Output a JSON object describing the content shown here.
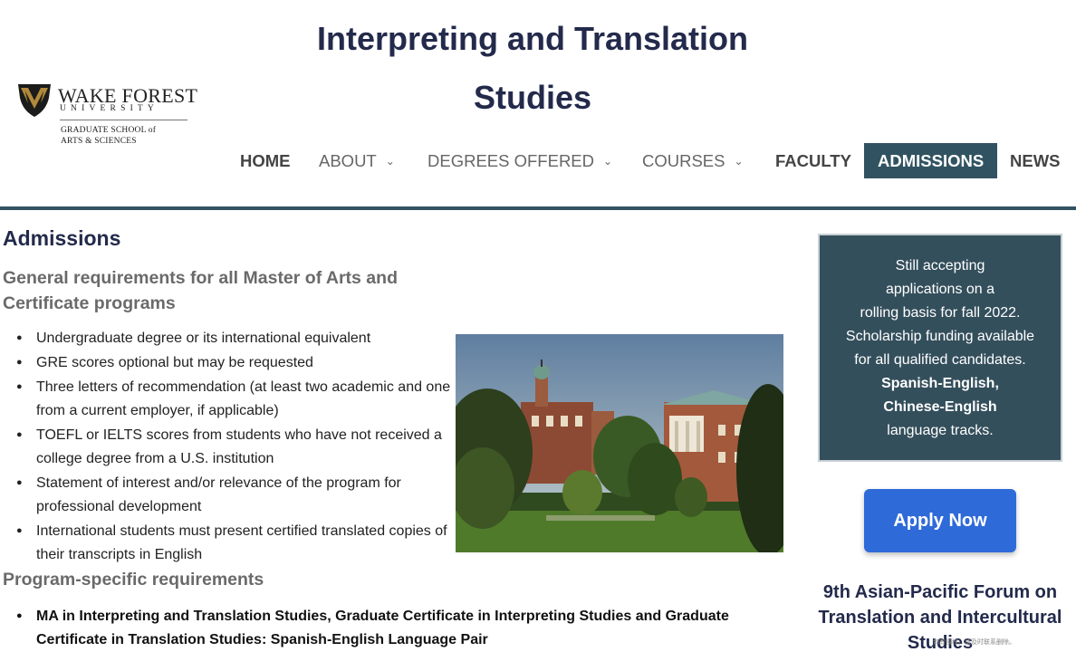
{
  "header": {
    "site_title": "Interpreting and Translation Studies",
    "logo": {
      "name": "WAKE FOREST",
      "university": "UNIVERSITY",
      "school_line1": "GRADUATE SCHOOL of",
      "school_line2": "ARTS & SCIENCES"
    }
  },
  "nav": {
    "items": [
      {
        "label": "HOME",
        "has_dropdown": false
      },
      {
        "label": "ABOUT",
        "has_dropdown": true
      },
      {
        "label": "DEGREES OFFERED",
        "has_dropdown": true
      },
      {
        "label": "COURSES",
        "has_dropdown": true
      },
      {
        "label": "FACULTY",
        "has_dropdown": false
      },
      {
        "label": "ADMISSIONS",
        "has_dropdown": false,
        "active": true
      },
      {
        "label": "NEWS",
        "has_dropdown": false
      }
    ],
    "dropdown_icon": "chevron-down-icon",
    "active_color": "#315361"
  },
  "main": {
    "page_title": "Admissions",
    "general_heading": "General requirements for all Master of Arts and Certificate programs",
    "general_requirements": [
      "Undergraduate degree or its international equivalent",
      "GRE scores optional but may be requested",
      "Three letters of recommendation (at least two academic and one from a current employer, if applicable)",
      "TOEFL or IELTS scores from students who have not received a college degree from a U.S. institution",
      "Statement of interest and/or relevance of the program for professional development",
      "International students must present certified translated copies of their transcripts in English"
    ],
    "program_heading": "Program-specific requirements",
    "program_requirements": [
      "MA in Interpreting and Translation Studies, Graduate Certificate in Interpreting Studies and Graduate Certificate in Translation Studies: Spanish-English Language Pair"
    ]
  },
  "sidebar": {
    "notice_lines": [
      {
        "text": "Still accepting",
        "bold": false
      },
      {
        "text": "applications on a",
        "bold": false
      },
      {
        "text": "rolling basis for fall 2022.",
        "bold": false
      },
      {
        "text": "Scholarship funding available",
        "bold": false
      },
      {
        "text": "for all qualified candidates.",
        "bold": false
      },
      {
        "text": "Spanish-English,",
        "bold": true
      },
      {
        "text": "Chinese-English",
        "bold": true
      },
      {
        "text": "language tracks.",
        "bold": false
      }
    ],
    "apply_label": "Apply Now",
    "apply_color": "#2f6ad9",
    "forum_title": "9th Asian-Pacific Forum on Translation and Intercultural Studies"
  },
  "watermark": "如有侵权，请及时联系删除。"
}
